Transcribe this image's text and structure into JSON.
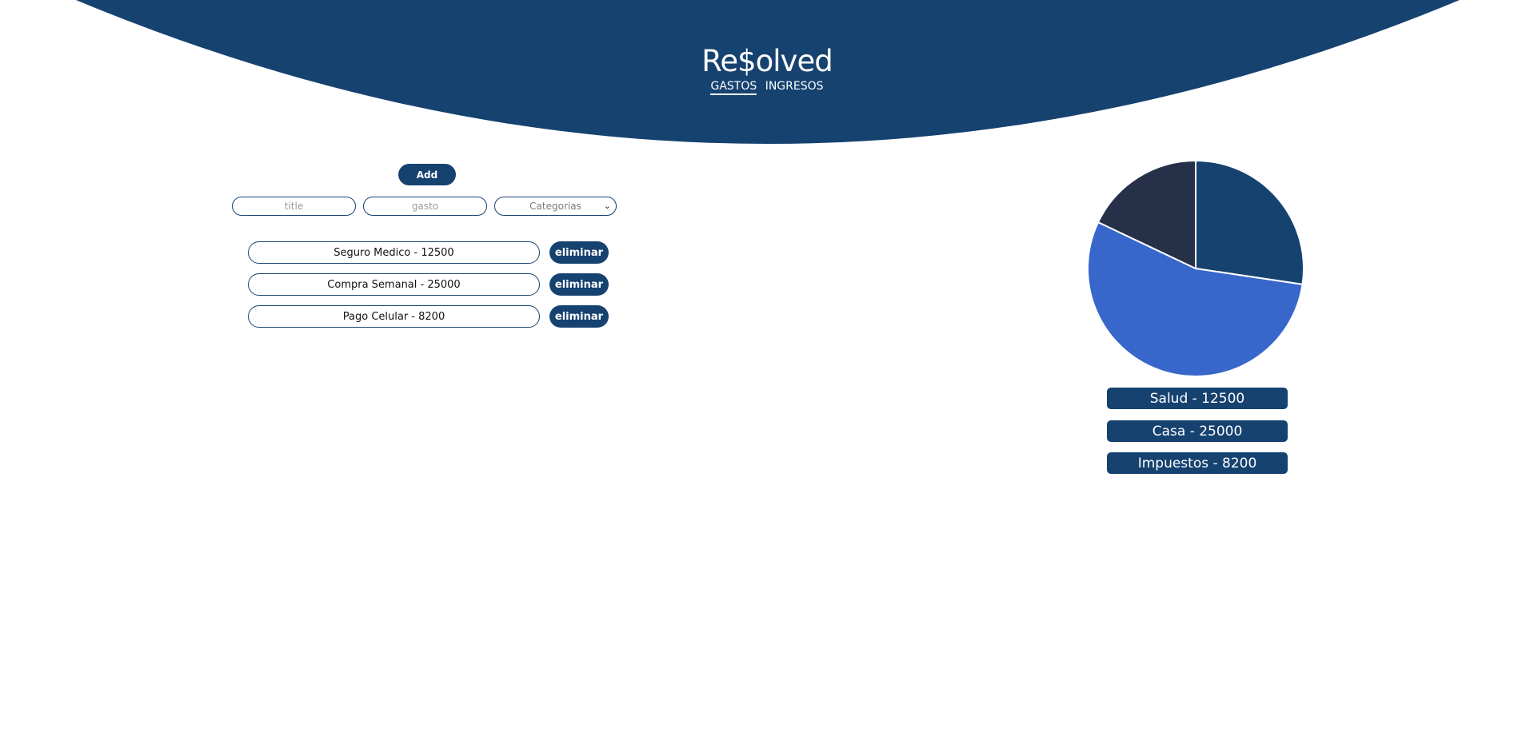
{
  "header": {
    "brand": "Re$olved",
    "nav": [
      {
        "label": "GASTOS",
        "active": true
      },
      {
        "label": "INGRESOS",
        "active": false
      }
    ],
    "color": "#164270"
  },
  "form": {
    "add_label": "Add",
    "title_placeholder": "title",
    "gasto_placeholder": "gasto",
    "category_selected": "Categorias"
  },
  "expenses": [
    {
      "text": "Seguro Medico - 12500",
      "delete_label": "eliminar"
    },
    {
      "text": "Compra Semanal - 25000",
      "delete_label": "eliminar"
    },
    {
      "text": "Pago Celular - 8200",
      "delete_label": "eliminar"
    }
  ],
  "chart_data": {
    "type": "pie",
    "categories": [
      "Salud",
      "Casa",
      "Impuestos"
    ],
    "values": [
      12500,
      25000,
      8200
    ],
    "colors": [
      "#164270",
      "#3867CB",
      "#263049"
    ],
    "title": ""
  },
  "legend": [
    {
      "label": "Salud - 12500"
    },
    {
      "label": "Casa - 25000"
    },
    {
      "label": "Impuestos - 8200"
    }
  ]
}
